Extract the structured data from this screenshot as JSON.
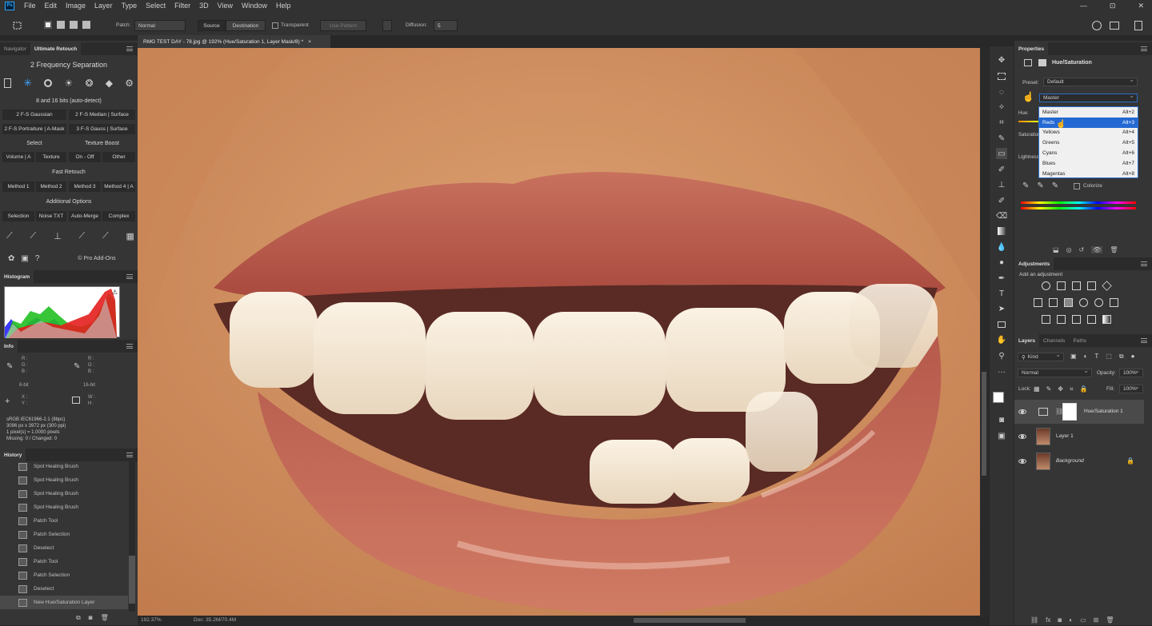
{
  "menubar": {
    "logo": "Ps",
    "items": [
      "File",
      "Edit",
      "Image",
      "Layer",
      "Type",
      "Select",
      "Filter",
      "3D",
      "View",
      "Window",
      "Help"
    ],
    "window_controls": [
      "—",
      "⊡",
      "✕"
    ]
  },
  "options": {
    "patch_label": "Patch:",
    "patch_mode": "Normal",
    "source": "Source",
    "destination": "Destination",
    "transparent": "Transparent",
    "use_pattern": "Use Pattern",
    "diffusion_label": "Diffusion:",
    "diffusion_value": "5"
  },
  "document": {
    "tab_title": "RMG TEST DAY - 78.jpg @ 192% (Hue/Saturation 1, Layer Mask/8) *",
    "close": "×",
    "zoom": "192.37%",
    "doc_size": "Doc: 35.2M/70.4M"
  },
  "left": {
    "tabs": [
      "Navigator",
      "Ultimate Retouch"
    ],
    "ur_title": "2 Frequency Separation",
    "bits_note": "8 and 16 bits (auto-detect)",
    "fs_buttons": [
      "2 F-S Gaussian",
      "2 F-S Median | Surface",
      "2 F-S Portraiture | A-Mask",
      "3 F-S Gauss | Surface"
    ],
    "select_head": "Select",
    "texture_head": "Texture Boost",
    "select_buttons": [
      "Volume | A",
      "Texture",
      "On - Off",
      "Other"
    ],
    "fast_head": "Fast Retouch",
    "fast_buttons": [
      "Method 1",
      "Method 2",
      "Method 3",
      "Method 4 | A"
    ],
    "add_head": "Additional Options",
    "add_buttons": [
      "Selection",
      "Noise TXT",
      "Auto-Merge",
      "Complex"
    ],
    "pro": "© Pro Add-Ons",
    "histogram_tab": "Histogram",
    "info_tab": "Info",
    "info": {
      "rgb": [
        "R :",
        "G :",
        "B :"
      ],
      "bit1": "8-bit",
      "bit2": "16-bit",
      "xy": [
        "X :",
        "Y :"
      ],
      "wh": [
        "W :",
        "H :"
      ],
      "doc_lines": [
        "sRGB IEC61966-2.1 (8bpc)",
        "3096 px x 3972 px (300 ppi)",
        "1 pixel(s) = 1.0000 pixels",
        "Missing: 0 / Changed: 0"
      ]
    },
    "history_tab": "History",
    "history": [
      "Spot Healing Brush",
      "Spot Healing Brush",
      "Spot Healing Brush",
      "Spot Healing Brush",
      "Patch Tool",
      "Patch Selection",
      "Deselect",
      "Patch Tool",
      "Patch Selection",
      "Deselect",
      "New Hue/Saturation Layer"
    ]
  },
  "properties": {
    "tab": "Properties",
    "title": "Hue/Saturation",
    "preset_label": "Preset:",
    "preset_value": "Default",
    "channel_value": "Master",
    "hue_label": "Hue:",
    "sat_label": "Saturation:",
    "light_label": "Lightness:",
    "colorize": "Colorize",
    "channels": [
      {
        "name": "Master",
        "key": "Alt+2"
      },
      {
        "name": "Reds",
        "key": "Alt+3"
      },
      {
        "name": "Yellows",
        "key": "Alt+4"
      },
      {
        "name": "Greens",
        "key": "Alt+5"
      },
      {
        "name": "Cyans",
        "key": "Alt+6"
      },
      {
        "name": "Blues",
        "key": "Alt+7"
      },
      {
        "name": "Magentas",
        "key": "Alt+8"
      }
    ]
  },
  "adjustments": {
    "tab": "Adjustments",
    "add_label": "Add an adjustment"
  },
  "layers": {
    "tabs": [
      "Layers",
      "Channels",
      "Paths"
    ],
    "kind": "Kind",
    "blend": "Normal",
    "opacity_label": "Opacity:",
    "opacity": "100%",
    "lock_label": "Lock:",
    "fill_label": "Fill:",
    "fill": "100%",
    "items": [
      {
        "name": "Hue/Saturation 1",
        "selected": true
      },
      {
        "name": "Layer 1",
        "selected": false
      },
      {
        "name": "Background",
        "selected": false
      }
    ]
  },
  "colors": {
    "accent": "#2468d3",
    "panel": "#353535",
    "dark": "#282828"
  }
}
